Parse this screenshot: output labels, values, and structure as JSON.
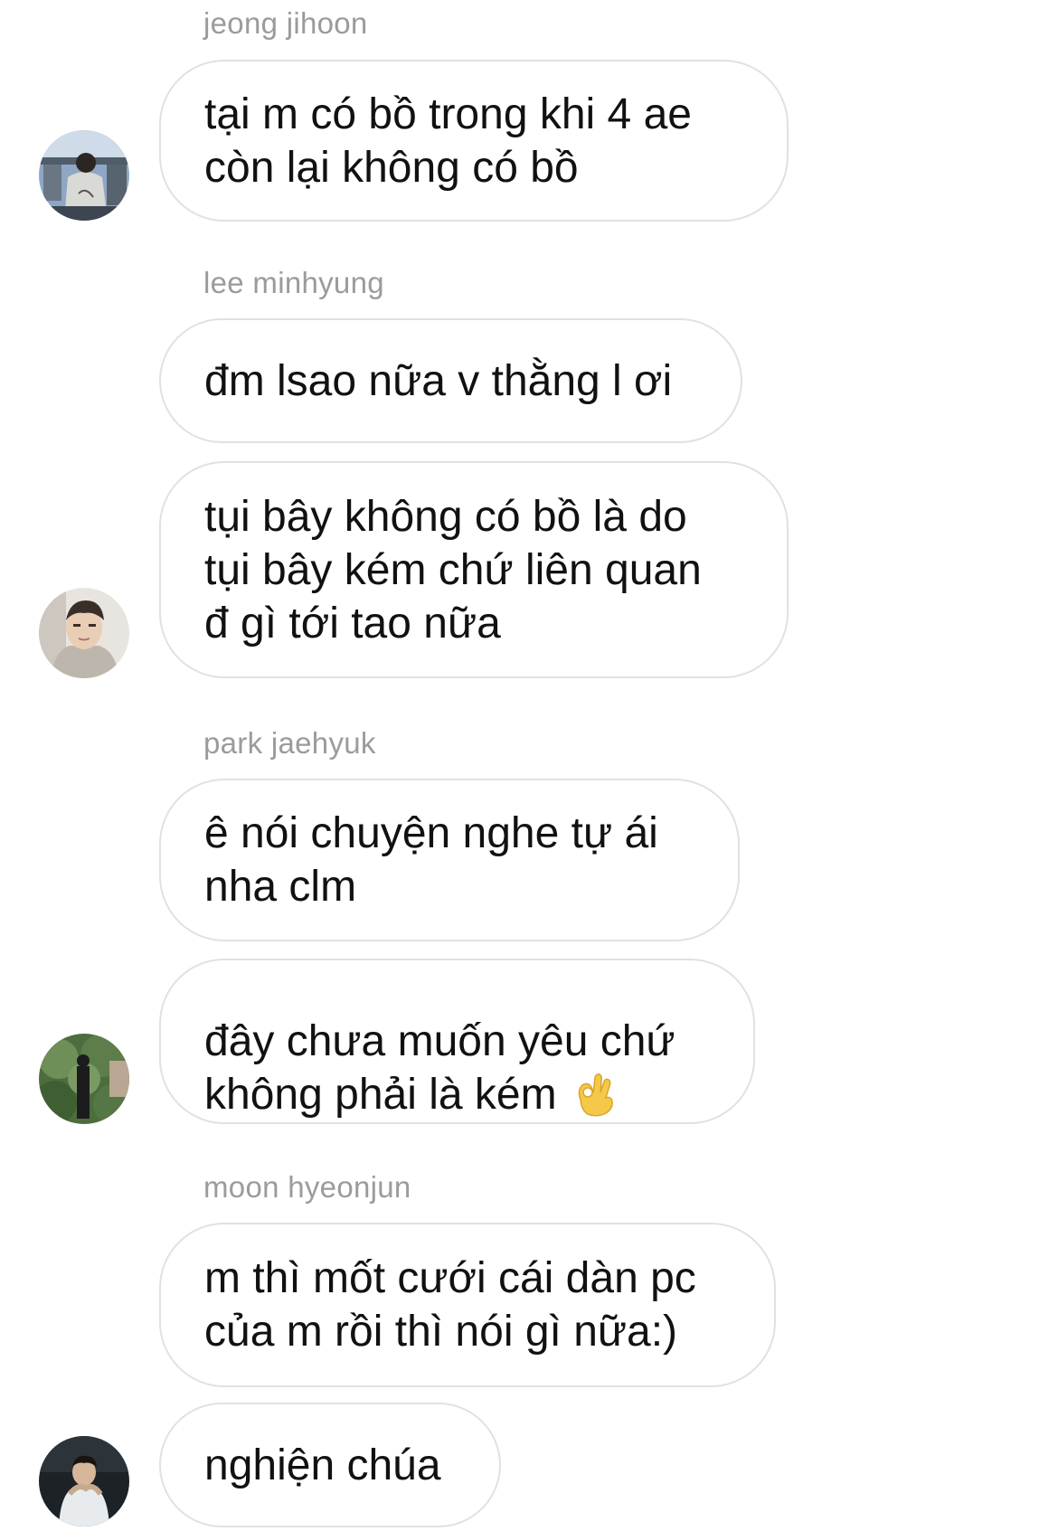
{
  "messages": [
    {
      "sender": "jeong jihoon",
      "bubbles": [
        "tại m có bồ trong khi 4 ae\ncòn lại không có bồ"
      ]
    },
    {
      "sender": "lee minhyung",
      "bubbles": [
        "đm lsao nữa v thằng l ơi",
        "tụi bây không có bồ là do\ntụi bây kém chứ liên quan\nđ gì tới tao nữa"
      ]
    },
    {
      "sender": "park jaehyuk",
      "bubbles": [
        "ê nói chuyện nghe tự ái\nnha clm",
        "đây chưa muốn yêu chứ\nkhông phải là kém"
      ]
    },
    {
      "sender": "moon hyeonjun",
      "bubbles": [
        "m thì mốt cưới cái dàn pc\ncủa m rồi thì nói gì nữa:)",
        "nghiện chúa"
      ]
    }
  ],
  "emoji": "ok-hand-emoji",
  "colors": {
    "background": "#ffffff",
    "bubble_border": "#e1e1e1",
    "name_text": "#9b9b9b",
    "message_text": "#111111"
  }
}
